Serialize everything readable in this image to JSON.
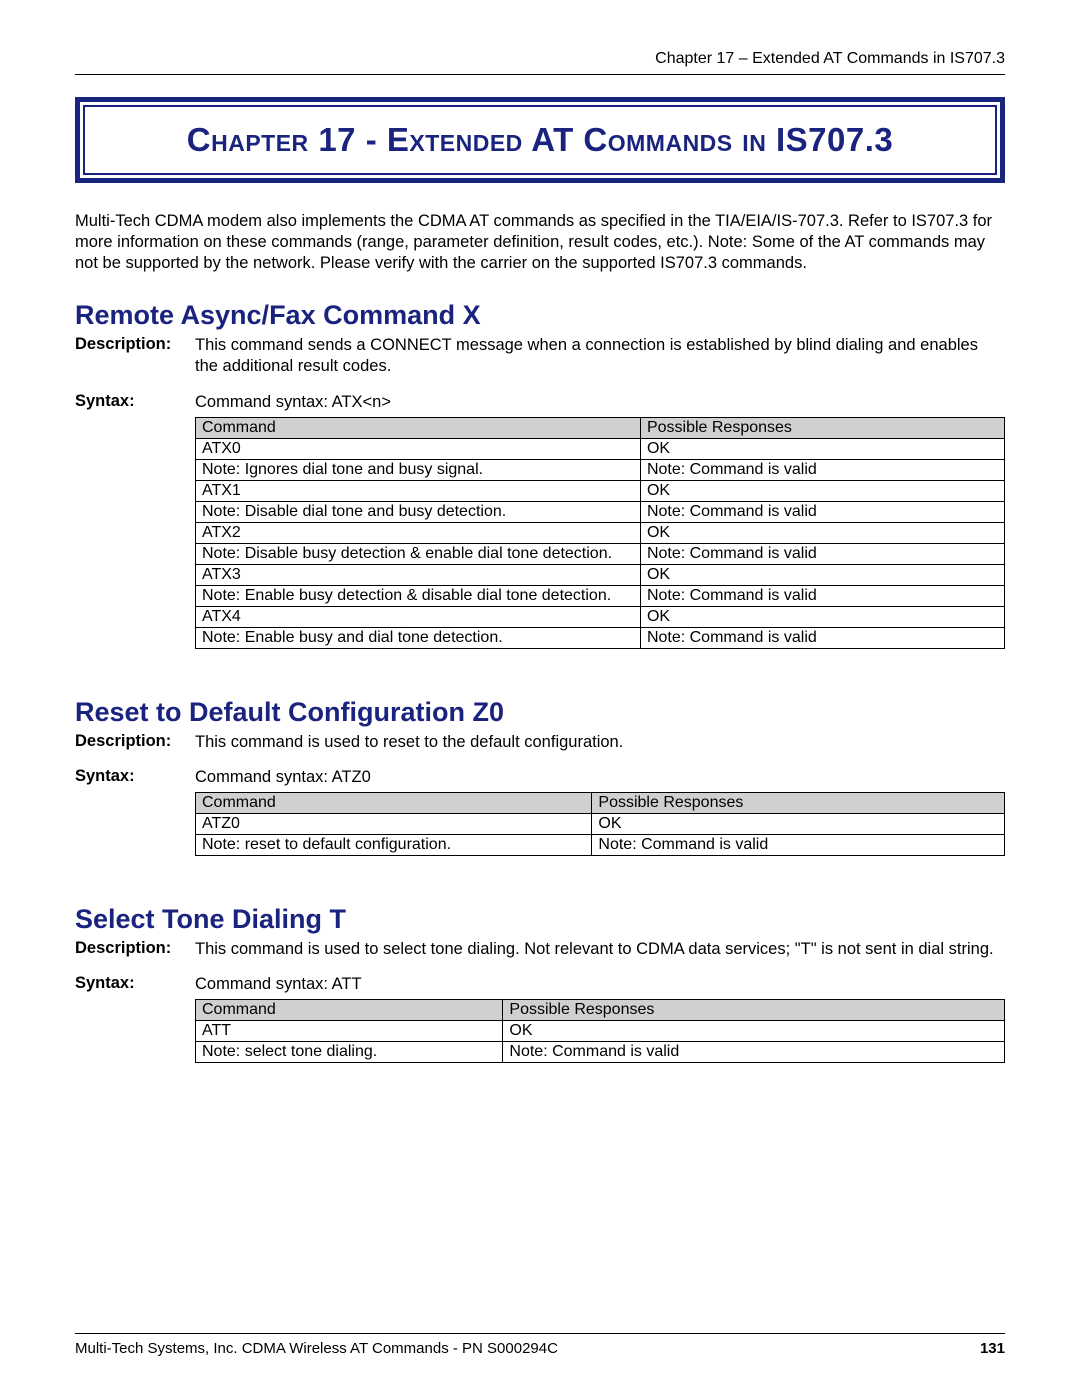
{
  "header": "Chapter 17 – Extended AT Commands in IS707.3",
  "chapter_title": "Chapter 17 - Extended AT Commands in IS707.3",
  "intro": "Multi-Tech CDMA modem also implements the CDMA AT commands as specified in the TIA/EIA/IS-707.3. Refer to IS707.3 for more information on these commands (range, parameter definition, result codes, etc.). Note: Some of the AT commands may not be supported by the network. Please verify with the carrier on the supported IS707.3 commands.",
  "labels": {
    "description": "Description:",
    "syntax": "Syntax:",
    "col_command": "Command",
    "col_responses": "Possible Responses"
  },
  "sections": [
    {
      "title": "Remote Async/Fax Command  X",
      "description": "This command sends a CONNECT message when a connection is established by blind dialing and enables the additional result codes.",
      "syntax": "Command syntax: ATX<n>",
      "rows": [
        {
          "cmd": "ATX0",
          "resp": "OK"
        },
        {
          "cmd": "Note: Ignores dial tone and busy signal.",
          "resp": "Note: Command is valid"
        },
        {
          "cmd": "ATX1",
          "resp": "OK"
        },
        {
          "cmd": "Note: Disable dial tone and busy detection.",
          "resp": "Note: Command is valid"
        },
        {
          "cmd": "ATX2",
          "resp": "OK"
        },
        {
          "cmd": "Note: Disable busy detection & enable dial tone detection.",
          "resp": "Note: Command is valid"
        },
        {
          "cmd": "ATX3",
          "resp": "OK"
        },
        {
          "cmd": "Note: Enable busy detection & disable dial tone detection.",
          "resp": "Note: Command is valid"
        },
        {
          "cmd": "ATX4",
          "resp": "OK"
        },
        {
          "cmd": "Note: Enable busy and dial tone detection.",
          "resp": "Note: Command is valid"
        }
      ],
      "col_widths": [
        "55%",
        "45%"
      ]
    },
    {
      "title": "Reset to Default Configuration  Z0",
      "description": "This command is used to reset to the default configuration.",
      "syntax": "Command syntax: ATZ0",
      "rows": [
        {
          "cmd": "ATZ0",
          "resp": "OK"
        },
        {
          "cmd": "Note: reset to default configuration.",
          "resp": "Note: Command is valid"
        }
      ],
      "col_widths": [
        "49%",
        "51%"
      ]
    },
    {
      "title": "Select Tone Dialing  T",
      "description": "This command is used to select tone dialing. Not relevant to CDMA data services; \"T\" is not sent in dial string.",
      "syntax": "Command syntax: ATT",
      "rows": [
        {
          "cmd": "ATT",
          "resp": "OK"
        },
        {
          "cmd": "Note: select tone dialing.",
          "resp": "Note: Command is valid"
        }
      ],
      "col_widths": [
        "38%",
        "62%"
      ]
    }
  ],
  "footer": {
    "left": "Multi-Tech Systems, Inc. CDMA Wireless AT Commands - PN S000294C",
    "right": "131"
  }
}
